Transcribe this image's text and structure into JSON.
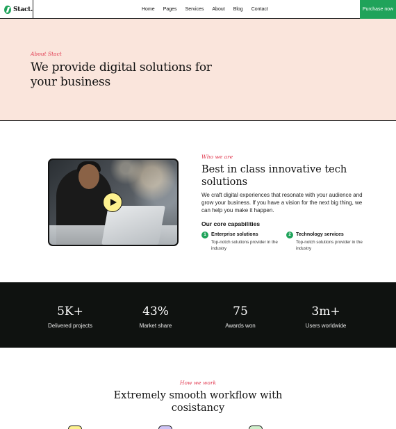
{
  "nav": {
    "logo_text": "Stact.",
    "menu": [
      "Home",
      "Pages",
      "Services",
      "About",
      "Blog",
      "Contact"
    ],
    "cta_label": "Purchase now"
  },
  "hero": {
    "eyebrow": "About Stact",
    "title": "We provide digital solutions for your business"
  },
  "about": {
    "eyebrow": "Who we are",
    "title": "Best in class innovative tech solutions",
    "text": "We craft digital experiences that resonate with your audience and grow your business. If you have a vision for the next big thing, we can help you make it happen.",
    "capabilities_title": "Our core capabilities",
    "capabilities": [
      {
        "num": "1",
        "name": "Enterprise solutions",
        "desc": "Top-notch solutions provider in the industry"
      },
      {
        "num": "2",
        "name": "Technology services",
        "desc": "Top-notch solutions provider in the industry"
      }
    ]
  },
  "stats": [
    {
      "value": "5K+",
      "label": "Delivered projects"
    },
    {
      "value": "43%",
      "label": "Market share"
    },
    {
      "value": "75",
      "label": "Awards won"
    },
    {
      "value": "3m+",
      "label": "Users worldwide"
    }
  ],
  "work": {
    "eyebrow": "How we work",
    "title": "Extremely smooth workflow with cosistancy",
    "step_colors": [
      "#fdf18f",
      "#cdc3f5",
      "#cfeecb"
    ]
  },
  "colors": {
    "accent": "#1fa35a",
    "hero_bg": "#fae5dc",
    "eyebrow": "#e0344b",
    "stats_bg": "#0f1210"
  }
}
